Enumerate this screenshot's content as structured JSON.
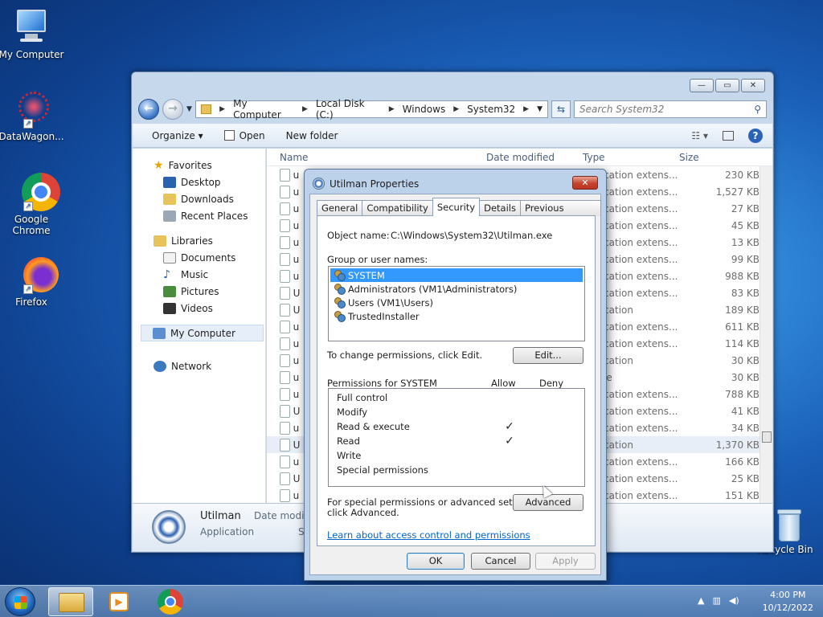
{
  "desktop": {
    "icons": [
      {
        "label": "My Computer"
      },
      {
        "label": "DataWagon..."
      },
      {
        "label": "Google Chrome"
      },
      {
        "label": "Firefox"
      },
      {
        "label": "Recycle Bin"
      }
    ]
  },
  "explorer": {
    "window_buttons": {
      "minimize": "▭",
      "maximize": "▭",
      "close": "✕"
    },
    "address": [
      "My Computer",
      "Local Disk (C:)",
      "Windows",
      "System32"
    ],
    "search_placeholder": "Search System32",
    "toolbar": {
      "organize": "Organize ▾",
      "open": "Open",
      "new_folder": "New folder"
    },
    "nav": {
      "favorites": "Favorites",
      "desktop": "Desktop",
      "downloads": "Downloads",
      "recent": "Recent Places",
      "libraries": "Libraries",
      "documents": "Documents",
      "music": "Music",
      "pictures": "Pictures",
      "videos": "Videos",
      "computer": "My Computer",
      "network": "Network"
    },
    "columns": {
      "name": "Name",
      "date": "Date modified",
      "type": "Type",
      "size": "Size"
    },
    "rows": [
      {
        "n": "u",
        "t": "cation extens...",
        "s": "230 KB"
      },
      {
        "n": "u",
        "t": "cation extens...",
        "s": "1,527 KB"
      },
      {
        "n": "u",
        "t": "cation extens...",
        "s": "27 KB"
      },
      {
        "n": "u",
        "t": "cation extens...",
        "s": "45 KB"
      },
      {
        "n": "u",
        "t": "cation extens...",
        "s": "13 KB"
      },
      {
        "n": "u",
        "t": "cation extens...",
        "s": "99 KB"
      },
      {
        "n": "u",
        "t": "cation extens...",
        "s": "988 KB"
      },
      {
        "n": "U",
        "t": "cation extens...",
        "s": "83 KB"
      },
      {
        "n": "U",
        "t": "cation",
        "s": "189 KB"
      },
      {
        "n": "u",
        "t": "cation extens...",
        "s": "611 KB"
      },
      {
        "n": "u",
        "t": "cation extens...",
        "s": "114 KB"
      },
      {
        "n": "u",
        "t": "cation",
        "s": "30 KB"
      },
      {
        "n": "u",
        "t": "le",
        "s": "30 KB"
      },
      {
        "n": "u",
        "t": "cation extens...",
        "s": "788 KB"
      },
      {
        "n": "U",
        "t": "cation extens...",
        "s": "41 KB"
      },
      {
        "n": "u",
        "t": "cation extens...",
        "s": "34 KB"
      },
      {
        "n": "U",
        "t": "cation",
        "s": "1,370 KB"
      },
      {
        "n": "u",
        "t": "cation extens...",
        "s": "166 KB"
      },
      {
        "n": "U",
        "t": "cation extens...",
        "s": "25 KB"
      },
      {
        "n": "u",
        "t": "cation extens...",
        "s": "151 KB"
      }
    ],
    "details": {
      "name": "Utilman",
      "type": "Application",
      "date_label": "Date modifi",
      "size_label": "S"
    }
  },
  "dialog": {
    "title": "Utilman Properties",
    "close": "✕",
    "tabs": [
      "General",
      "Compatibility",
      "Security",
      "Details",
      "Previous Versions"
    ],
    "object_label": "Object name:",
    "object_value": "C:\\Windows\\System32\\Utilman.exe",
    "group_label": "Group or user names:",
    "users": [
      "SYSTEM",
      "Administrators (VM1\\Administrators)",
      "Users (VM1\\Users)",
      "TrustedInstaller"
    ],
    "change_text": "To change permissions, click Edit.",
    "edit_btn": "Edit...",
    "perm_label": "Permissions for SYSTEM",
    "allow": "Allow",
    "deny": "Deny",
    "permissions": [
      {
        "name": "Full control",
        "allow": ""
      },
      {
        "name": "Modify",
        "allow": ""
      },
      {
        "name": "Read & execute",
        "allow": "✓"
      },
      {
        "name": "Read",
        "allow": "✓"
      },
      {
        "name": "Write",
        "allow": ""
      },
      {
        "name": "Special permissions",
        "allow": ""
      }
    ],
    "special_text_1": "For special permissions or advanced settings,",
    "special_text_2": "click Advanced.",
    "advanced_btn": "Advanced",
    "learn_link": "Learn about access control and permissions",
    "ok": "OK",
    "cancel": "Cancel",
    "apply": "Apply"
  },
  "taskbar": {
    "time": "4:00 PM",
    "date": "10/12/2022"
  }
}
